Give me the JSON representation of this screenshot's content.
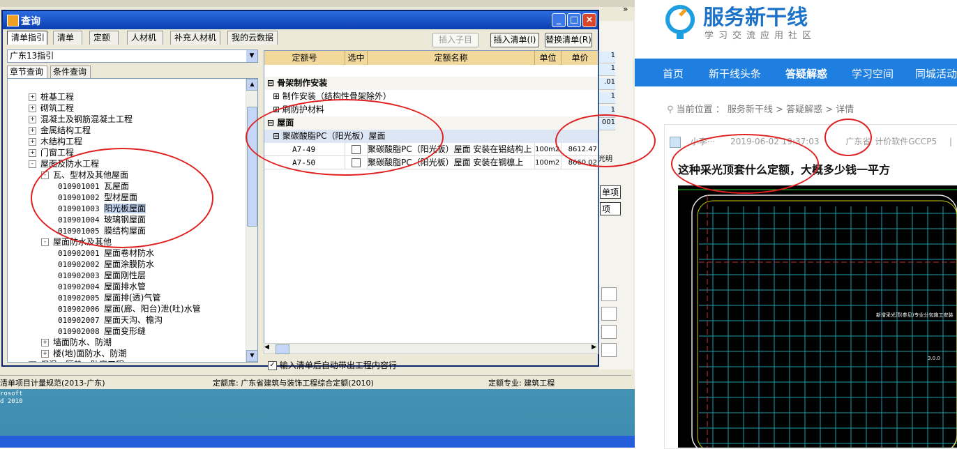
{
  "dialog": {
    "title": "查询",
    "tabs": [
      "清单指引",
      "清单",
      "定额",
      "人材机",
      "补充人材机",
      "我的云数据"
    ],
    "buttons": {
      "insert_child": "插入子目",
      "insert_list": "插入清单(I)",
      "replace_list": "替换清单(R)"
    },
    "library": "广东13指引",
    "subtabs": [
      "章节查询",
      "条件查询"
    ],
    "tree": [
      {
        "label": "桩基工程",
        "level": 1,
        "toggle": "+"
      },
      {
        "label": "砌筑工程",
        "level": 1,
        "toggle": "+"
      },
      {
        "label": "混凝土及钢筋混凝土工程",
        "level": 1,
        "toggle": "+"
      },
      {
        "label": "金属结构工程",
        "level": 1,
        "toggle": "+"
      },
      {
        "label": "木结构工程",
        "level": 1,
        "toggle": "+"
      },
      {
        "label": "门窗工程",
        "level": 1,
        "toggle": "+"
      },
      {
        "label": "屋面及防水工程",
        "level": 1,
        "toggle": "-"
      },
      {
        "label": "瓦、型材及其他屋面",
        "level": 2,
        "toggle": "-"
      },
      {
        "code": "010901001",
        "label": "瓦屋面",
        "level": 3
      },
      {
        "code": "010901002",
        "label": "型材屋面",
        "level": 3
      },
      {
        "code": "010901003",
        "label": "阳光板屋面",
        "level": 3,
        "selected": true
      },
      {
        "code": "010901004",
        "label": "玻璃钢屋面",
        "level": 3
      },
      {
        "code": "010901005",
        "label": "膜结构屋面",
        "level": 3
      },
      {
        "label": "屋面防水及其他",
        "level": 2,
        "toggle": "-"
      },
      {
        "code": "010902001",
        "label": "屋面卷材防水",
        "level": 3
      },
      {
        "code": "010902002",
        "label": "屋面涂膜防水",
        "level": 3
      },
      {
        "code": "010902003",
        "label": "屋面刚性层",
        "level": 3
      },
      {
        "code": "010902004",
        "label": "屋面排水管",
        "level": 3
      },
      {
        "code": "010902005",
        "label": "屋面排(透)气管",
        "level": 3
      },
      {
        "code": "010902006",
        "label": "屋面(廊、阳台)泄(吐)水管",
        "level": 3
      },
      {
        "code": "010902007",
        "label": "屋面天沟、檐沟",
        "level": 3
      },
      {
        "code": "010902008",
        "label": "屋面变形缝",
        "level": 3
      },
      {
        "label": "墙面防水、防潮",
        "level": 2,
        "toggle": "+"
      },
      {
        "label": "楼(地)面防水、防潮",
        "level": 2,
        "toggle": "+"
      },
      {
        "label": "保温、隔热、防腐工程",
        "level": 1,
        "toggle": "+"
      }
    ],
    "grid": {
      "headers": [
        "定额号",
        "选中",
        "定额名称",
        "单位",
        "单价"
      ],
      "groups": [
        {
          "label": "骨架制作安装",
          "toggle": "-",
          "rows": [
            {
              "kind": "sub",
              "label": "制作安装（结构性骨架除外）",
              "toggle": "+"
            },
            {
              "kind": "sub",
              "label": "刷防护材料",
              "toggle": "+"
            }
          ]
        },
        {
          "label": "屋面",
          "toggle": "-",
          "rows": [
            {
              "kind": "subgroup",
              "label": "聚碳酸脂PC（阳光板）屋面",
              "toggle": "-"
            },
            {
              "kind": "item",
              "code": "A7-49",
              "name": "聚碳酸脂PC（阳光板）屋面 安装在铝结构上",
              "unit": "100m2",
              "price": "8612.47"
            },
            {
              "kind": "item",
              "code": "A7-50",
              "name": "聚碳酸脂PC（阳光板）屋面 安装在钢檩上",
              "unit": "100m2",
              "price": "8660.02"
            }
          ]
        }
      ]
    },
    "auto_check": "输入清单后自动带出工程内容行"
  },
  "status_bar": {
    "left": "清单项目计量规范(2013-广东)",
    "middle": "定额库: 广东省建筑与装饰工程综合定额(2010)",
    "right": "定额专业: 建筑工程"
  },
  "bg_app": {
    "right_cells": [
      "1",
      "1",
      ".01",
      "1",
      "1",
      "001"
    ],
    "labels": {
      "b1": "单项",
      "b2": "项",
      "c1": "光明"
    },
    "chevron": "»"
  },
  "desktop": {
    "word_label": "rosoft\nd 2010"
  },
  "web": {
    "brand": "服务新干线",
    "slogan": "学习交流应用社区",
    "nav": [
      "首页",
      "新干线头条",
      "答疑解惑",
      "学习空间",
      "同城活动"
    ],
    "crumb": "当前位置 ： 服务新干线 > 答疑解惑 > 详情",
    "meta_user": "小李···",
    "meta_time": "2019-06-02 19:37:03",
    "meta_region": "广东省",
    "meta_soft": "计价软件GCCP5",
    "meta_sep": "|",
    "question": "这种采光顶套什么定额，大概多少钱一平方",
    "cad_text": "新增采光顶(参见)专业分包施工安装",
    "cad_dim": "3.0.0"
  },
  "colors": {
    "accent": "#1e7fe0",
    "titlebar": "#0b3fb0",
    "annotation": "#e02020",
    "grid_header": "#f2d89a"
  }
}
